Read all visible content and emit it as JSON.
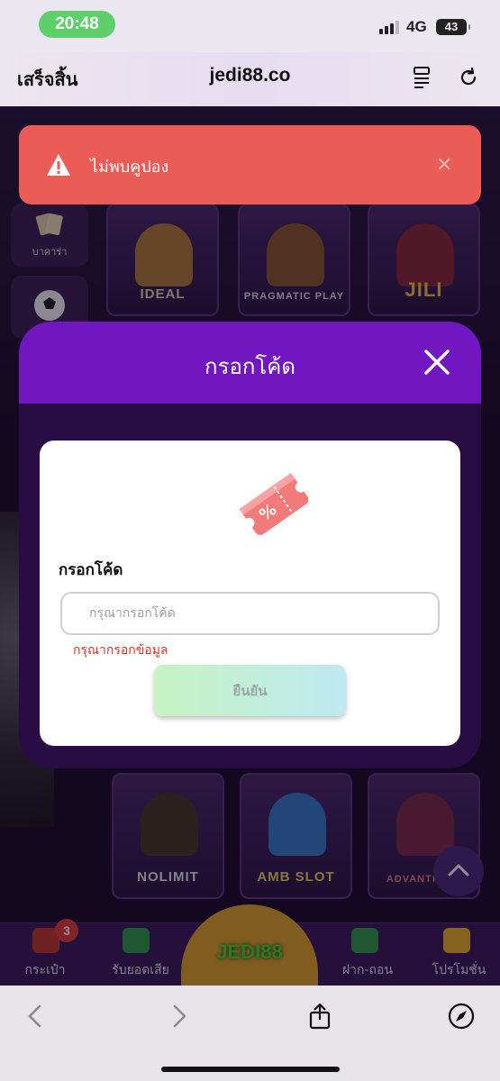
{
  "status_bar": {
    "time": "20:48",
    "network": "4G",
    "battery": "43"
  },
  "browser": {
    "done_label": "เสร็จสิ้น",
    "url": "jedi88.co"
  },
  "background": {
    "side_categories": [
      {
        "label": "บาคาร่า"
      },
      {
        "label": ""
      }
    ],
    "game_providers": [
      "IDEAL",
      "PRAGMATIC PLAY",
      "JILI",
      "NOLIMIT",
      "AMB SLOT",
      "ADVANTPLAY"
    ]
  },
  "toast": {
    "message": "ไม่พบคูปอง",
    "close_symbol": "✕"
  },
  "modal": {
    "title": "กรอกโค้ด",
    "field_label": "กรอกโค้ด",
    "input_placeholder": "กรุณากรอกโค้ด",
    "input_value": "",
    "error_text": "กรุณากรอกข้อมูล",
    "confirm_label": "ยืนยัน"
  },
  "bottom_nav": {
    "items": [
      {
        "label": "กระเป๋า",
        "icon": "wallet-icon",
        "badge": "3"
      },
      {
        "label": "รับยอดเสีย",
        "icon": "cashback-icon"
      },
      {
        "label": "JEDI88",
        "icon": "home-logo"
      },
      {
        "label": "ฝาก-ถอน",
        "icon": "deposit-icon"
      },
      {
        "label": "โปรโมชั่น",
        "icon": "promotion-icon"
      }
    ]
  },
  "colors": {
    "toast_bg": "#eb5c57",
    "modal_header": "#7117c2",
    "modal_body": "#2a0c45",
    "error": "#c9372c",
    "status_time_bg": "#5fcf6b"
  }
}
